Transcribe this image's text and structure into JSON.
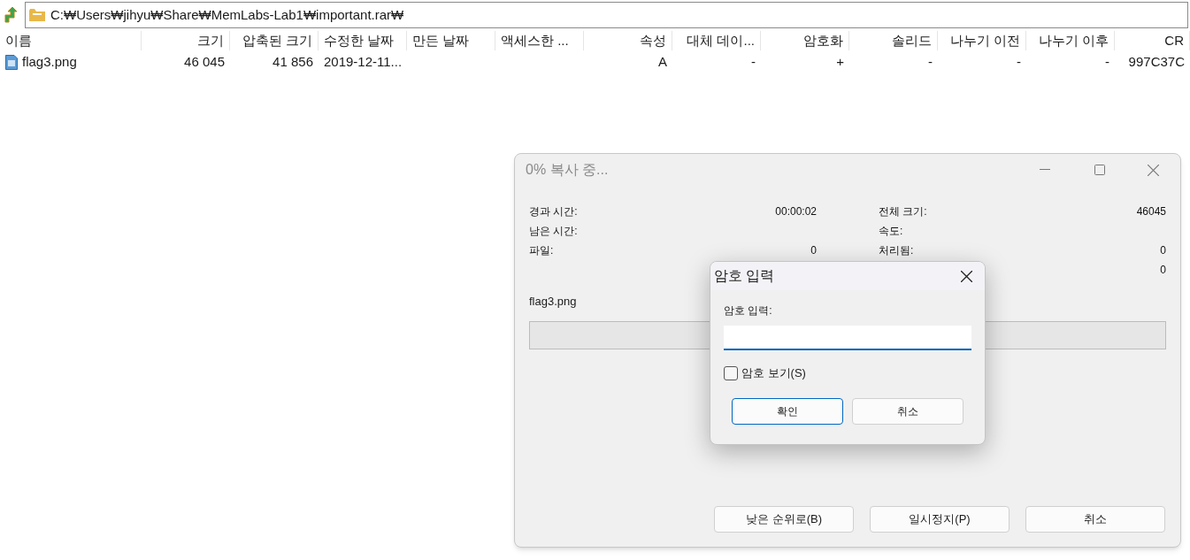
{
  "address_bar": {
    "path": "C:₩Users₩jihyu₩Share₩MemLabs-Lab1₩important.rar₩"
  },
  "table": {
    "columns": [
      "이름",
      "크기",
      "압축된 크기",
      "수정한 날짜",
      "만든 날짜",
      "액세스한 ...",
      "속성",
      "대체 데이...",
      "암호화",
      "솔리드",
      "나누기 이전",
      "나누기 이후",
      "CR"
    ],
    "rows": [
      {
        "cells": [
          "flag3.png",
          "46 045",
          "41 856",
          "2019-12-11...",
          null,
          null,
          "A",
          "-",
          "+",
          "-",
          "-",
          "-",
          "997C37C"
        ]
      }
    ]
  },
  "progress_window": {
    "title": "0% 복사 중...",
    "stats_left": [
      {
        "label": "경과 시간:",
        "value": "00:00:02"
      },
      {
        "label": "남은 시간:"
      },
      {
        "label": "파일:",
        "value": "0"
      }
    ],
    "stats_right": [
      {
        "label": "전체 크기:",
        "value": "46045"
      },
      {
        "label": "속도:"
      },
      {
        "label": "처리됨:",
        "value": "0"
      },
      {
        "value": "0"
      }
    ],
    "current_file": "flag3.png",
    "progress": {
      "level": 0
    },
    "buttons": [
      {
        "label": "낮은 순위로(B)"
      },
      {
        "label": "일시정지(P)"
      },
      {
        "label": "취소"
      }
    ]
  },
  "password_dialog": {
    "title": "암호 입력",
    "field_label": "암호 입력:",
    "show_password": {
      "label": "암호 보기(S)",
      "checked": false
    },
    "buttons": [
      {
        "label": "확인",
        "default": true
      },
      {
        "label": "취소",
        "default": false
      }
    ]
  }
}
